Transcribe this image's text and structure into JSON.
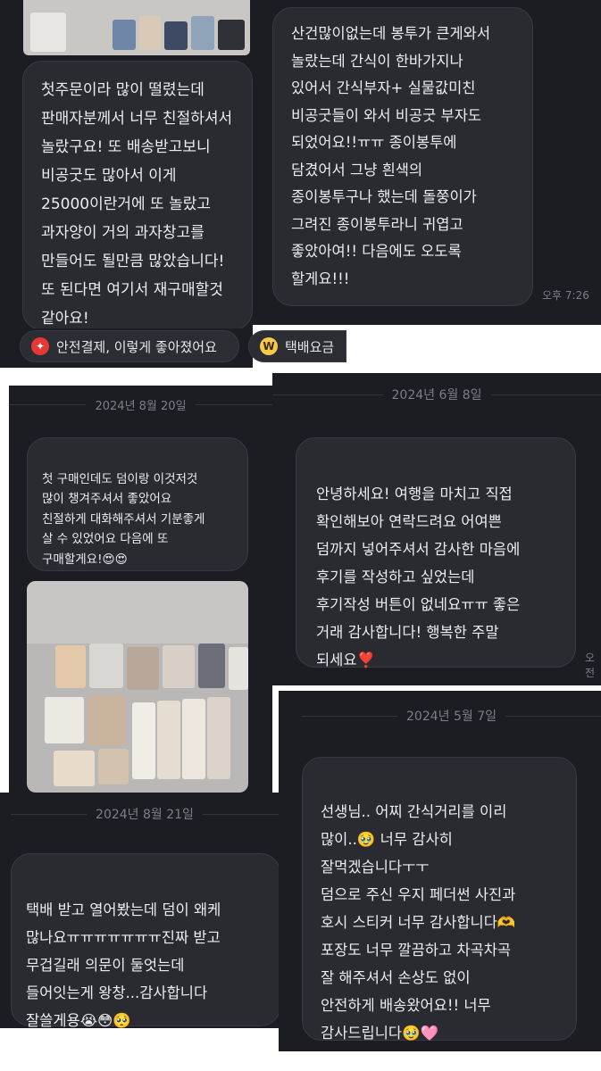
{
  "reviews": {
    "r1_text": "첫주문이라 많이 떨렸는데\n판매자분께서 너무 친절하셔서\n놀랐구요! 또 배송받고보니\n비공굿도 많아서 이게\n25000이란거에 또 놀랐고\n과자양이 거의 과자창고를\n만들어도 될만큼 많았습니다!\n또 된다면 여기서 재구매할것\n같아요!",
    "r2_text": "산건많이없는데 봉투가 큰게와서\n놀랐는데 간식이 한바가지나\n있어서 간식부자+ 실물값미친\n비공굿들이 와서 비공굿 부자도\n되었어요!!ㅠㅠ 종이봉투에\n담겼어서 그냥 흰색의\n종이봉투구나 했는데 돌쭝이가\n그려진 종이봉투라니 귀엽고\n좋았아여!! 다음에도 오도록\n할게요!!!",
    "r2_time": "오후 7:26",
    "r3_date": "2024년 8월 20일",
    "r3_text": "첫 구매인데도 덤이랑 이것저것\n많이 챙겨주셔서 좋았어요\n친절하게 대화해주셔서 기분좋게\n살 수 있었어요 다음에 또\n구매할게요!",
    "r3_emoji": "😍😍",
    "r4_date": "2024년 6월 8일",
    "r4_text": "안녕하세요! 여행을 마치고 직접\n확인해보아 연락드려요 어여쁜\n덤까지 넣어주셔서 감사한 마음에\n후기를 작성하고 싶었는데\n후기작성 버튼이 없네요ㅠㅠ 좋은\n거래 감사합니다! 행복한 주말\n되세요",
    "r4_emoji": "❣️",
    "r4_time_partial": "오전",
    "r5_date": "2024년 8월 21일",
    "r5_text": "택배 받고 열어봤는데 덤이 왜케\n많나요ㅠㅠㅠㅠㅠㅠㅠ진짜 받고\n무겁길래 의문이 둘엇는데\n들어잇는게 왕창...감사합니다\n잘쓸게용",
    "r5_emoji": "😭😳🥺",
    "r6_date": "2024년 5월 7일",
    "r6_line1": "선생님.. 어찌 간식거리를 이리",
    "r6_line2a": "많이..",
    "r6_line2b": "너무 감사히",
    "r6_rest": "잘먹겠습니다ㅜㅜ\n덤으로 주신 우지 페더썬 사진과\n호시 스티커 너무 감사합니다",
    "r6_rest2": "포장도 너무 깔끔하고 차곡차곡\n잘 해주셔서 손상도 없이\n안전하게 배송왔어요!! 너무\n감사드립니다",
    "r6_emoji_a": "🥹",
    "r6_emoji_b": "🫶",
    "r6_emoji_c": "🥹🩷"
  },
  "chips": {
    "safe_pay": "안전결제, 이렇게 좋아졌어요",
    "delivery_fee": "택배요금"
  },
  "colors": {
    "panel_bg": "#1c1d22",
    "bubble_bg": "#2a2b31",
    "safe_pay_icon": "#e53935",
    "delivery_icon": "#f7c948"
  }
}
